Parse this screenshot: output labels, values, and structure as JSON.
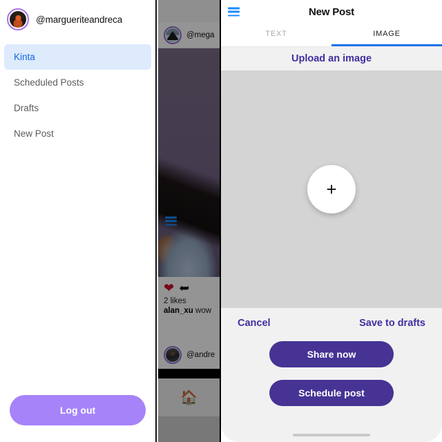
{
  "sidebar": {
    "avatar_name": "user-avatar",
    "handle": "@margueriteandreca",
    "items": [
      {
        "label": "Kinta",
        "active": true
      },
      {
        "label": "Scheduled Posts",
        "active": false
      },
      {
        "label": "Drafts",
        "active": false
      },
      {
        "label": "New Post",
        "active": false
      }
    ],
    "logout_label": "Log out",
    "accent_active_bg": "#ddebfd",
    "accent_active_text": "#1266e2",
    "logout_color": "#a683f8"
  },
  "phone_preview": {
    "menu_icon": "hamburger-icon",
    "post_one": {
      "handle": "@mega",
      "avatar_name": "mountain-avatar"
    },
    "actions": {
      "like_icon": "heart-icon",
      "share_icon": "reply-arrow-icon"
    },
    "likes_text": "2 likes",
    "comment_author": "alan_xu",
    "comment_text": "wow",
    "post_two": {
      "handle": "@andre",
      "avatar_name": "person-avatar"
    },
    "tabbar": {
      "home_icon": "home-icon"
    }
  },
  "modal": {
    "menu_icon": "hamburger-icon",
    "title": "New Post",
    "tabs": [
      {
        "label": "TEXT",
        "active": false
      },
      {
        "label": "IMAGE",
        "active": true
      }
    ],
    "upload_label": "Upload an image",
    "dropzone": {
      "plus_glyph": "+",
      "icon_name": "add-image-icon"
    },
    "cancel_label": "Cancel",
    "save_drafts_label": "Save to drafts",
    "share_now_label": "Share now",
    "schedule_post_label": "Schedule post",
    "link_color": "#3f2fa0",
    "button_color": "#463394",
    "tab_underline_color": "#1a73e8"
  }
}
